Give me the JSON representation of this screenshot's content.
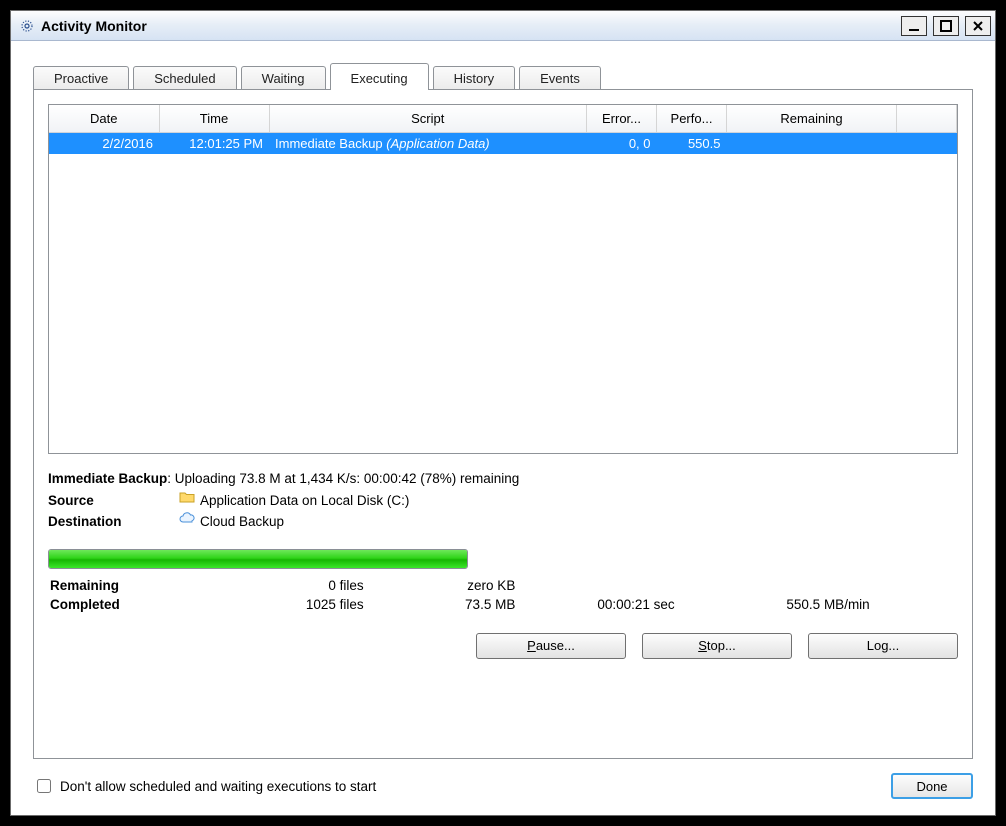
{
  "window": {
    "title": "Activity Monitor"
  },
  "tabs": {
    "items": [
      {
        "label": "Proactive"
      },
      {
        "label": "Scheduled"
      },
      {
        "label": "Waiting"
      },
      {
        "label": "Executing",
        "active": true
      },
      {
        "label": "History"
      },
      {
        "label": "Events"
      }
    ]
  },
  "grid": {
    "columns": {
      "date": "Date",
      "time": "Time",
      "script": "Script",
      "errors": "Error...",
      "perfo": "Perfo...",
      "remaining": "Remaining"
    },
    "rows": [
      {
        "date": "2/2/2016",
        "time": "12:01:25 PM",
        "script_main": "Immediate Backup",
        "script_detail": "(Application Data)",
        "errors": "0, 0",
        "perfo": "550.5",
        "remaining": ""
      }
    ]
  },
  "status": {
    "headline_label": "Immediate Backup",
    "headline_text": ": Uploading 73.8 M at 1,434 K/s: 00:00:42 (78%) remaining",
    "source_label": "Source",
    "source_text": "Application Data on Local Disk (C:)",
    "destination_label": "Destination",
    "destination_text": "Cloud Backup"
  },
  "progress": {
    "percent": 100
  },
  "stats": {
    "remaining_label": "Remaining",
    "remaining_files": "0 files",
    "remaining_size": "zero KB",
    "completed_label": "Completed",
    "completed_files": "1025 files",
    "completed_size": "73.5 MB",
    "completed_time": "00:00:21 sec",
    "completed_rate": "550.5 MB/min"
  },
  "buttons": {
    "pause": "Pause...",
    "stop": "Stop...",
    "log": "Log..."
  },
  "footer": {
    "checkbox_label": "Don't allow scheduled and waiting executions to start",
    "done": "Done"
  }
}
